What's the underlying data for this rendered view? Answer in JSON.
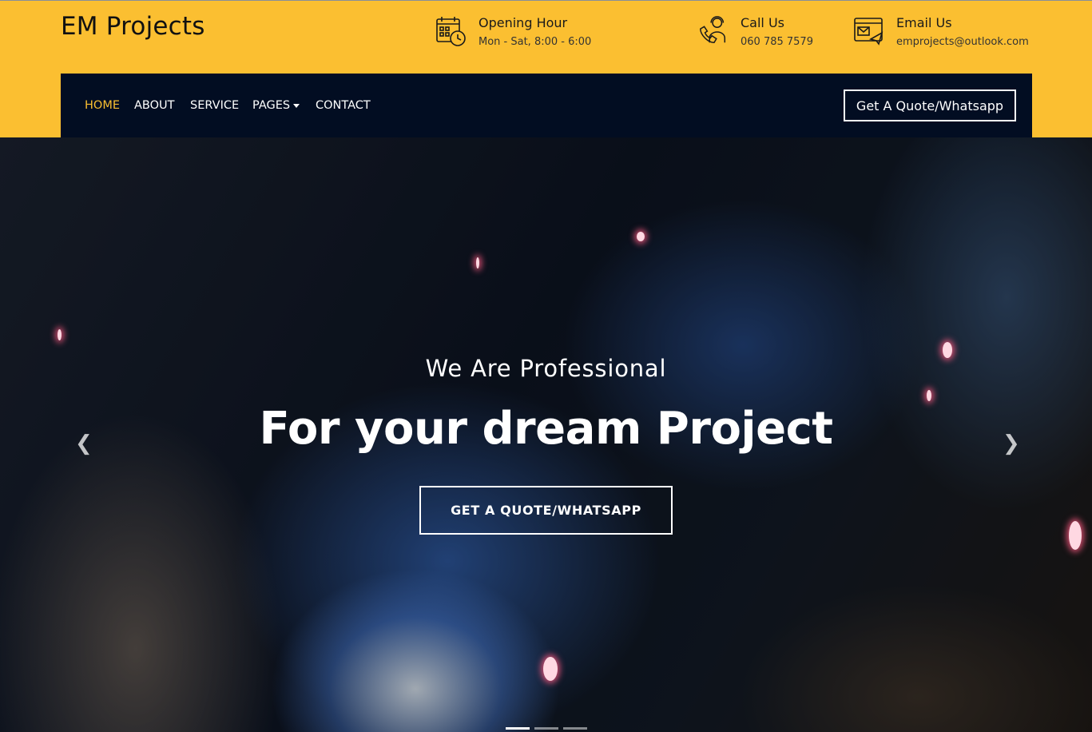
{
  "brand": {
    "name": "EM Projects"
  },
  "header_info": [
    {
      "icon": "calendar-clock-icon",
      "title": "Opening Hour",
      "value": "Mon - Sat, 8:00 - 6:00"
    },
    {
      "icon": "support-agent-icon",
      "title": "Call Us",
      "value": "060 785 7579"
    },
    {
      "icon": "email-send-icon",
      "title": "Email Us",
      "value": "emprojects@outlook.com"
    }
  ],
  "nav": {
    "items": [
      {
        "label": "HOME",
        "active": true
      },
      {
        "label": "ABOUT"
      },
      {
        "label": "SERVICE"
      },
      {
        "label": "PAGES",
        "dropdown": true
      },
      {
        "label": "CONTACT"
      }
    ],
    "cta_label": "Get A Quote/Whatsapp"
  },
  "hero": {
    "subtitle": "We Are Professional",
    "title": "For your dream Project",
    "button_label": "GET A QUOTE/WHATSAPP",
    "prev_icon": "chevron-left-icon",
    "next_icon": "chevron-right-icon",
    "slide_count": 3,
    "active_slide": 1
  },
  "colors": {
    "accent": "#fbbf31",
    "navbar_bg": "#020d22",
    "text_light": "#ffffff"
  }
}
